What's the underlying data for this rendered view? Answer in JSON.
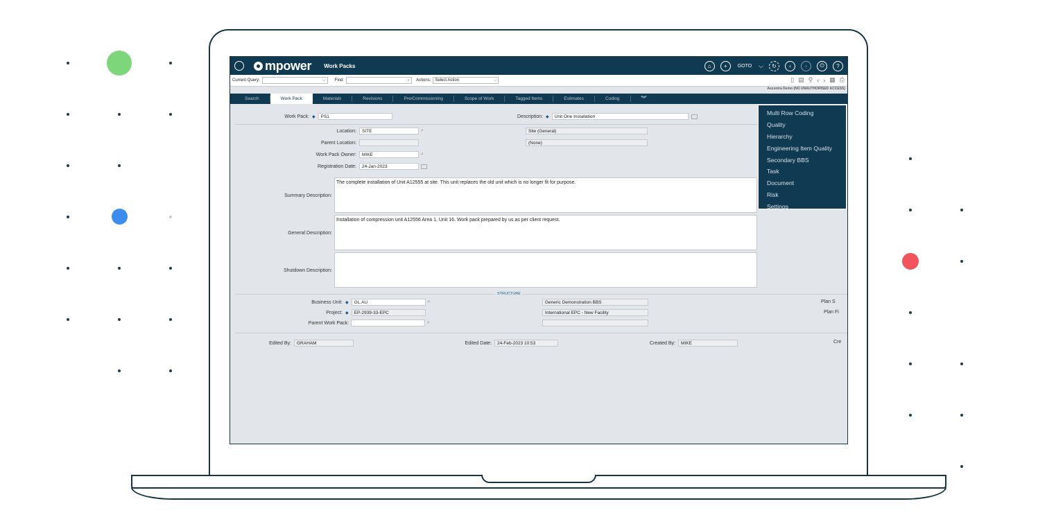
{
  "app": {
    "brand": "mpower",
    "module_title": "Work Packs",
    "goto_label": "GOTO",
    "access_note": "Ascentra Demo (NO UNAUTHORISED ACCESS)"
  },
  "querybar": {
    "current_query_label": "Current Query:",
    "current_query_value": "",
    "find_label": "Find:",
    "find_value": "",
    "actions_label": "Actions:",
    "actions_value": "Select Action"
  },
  "tabs": [
    {
      "label": "Search"
    },
    {
      "label": "Work Pack"
    },
    {
      "label": "Materials"
    },
    {
      "label": "Revisions"
    },
    {
      "label": "Pre/Commissioning"
    },
    {
      "label": "Scope of Work"
    },
    {
      "label": "Tagged Items"
    },
    {
      "label": "Estimates"
    },
    {
      "label": "Coding"
    }
  ],
  "form": {
    "work_pack_label": "Work Pack:",
    "work_pack_value": "PS1",
    "description_label": "Description:",
    "description_value": "Unit One Installation",
    "location_label": "Location:",
    "location_value": "SITE",
    "location_desc": "Site (General)",
    "parent_location_label": "Parent Location:",
    "parent_location_value": "",
    "parent_location_desc": "(None)",
    "owner_label": "Work Pack Owner:",
    "owner_value": "MIKE",
    "registration_label": "Registration Date:",
    "registration_value": "24-Jan-2023",
    "summary_label": "Summary Description:",
    "summary_value": "The complete installation of Unit A12555 at site. This unit replaces the old unit which is no longer fit for purpose.",
    "general_label": "General Description:",
    "general_value": "Installation of compression unit A12556 Area 1, Unit 16. Work pack prepared by us as per client request.",
    "shutdown_label": "Shutdown Description:",
    "shutdown_value": "",
    "structure_heading": "STRUCTURE",
    "business_unit_label": "Business Unit:",
    "business_unit_value": "GL.AU",
    "business_unit_desc": "Generic Demonstration BBS",
    "project_label": "Project:",
    "project_value": "EP-2939-33-EPC",
    "project_desc": "International EPC - New Facility",
    "parent_wp_label": "Parent Work Pack:",
    "parent_wp_value": "",
    "plan_start_label": "Plan S",
    "plan_finish_label": "Plan Fi",
    "edited_by_label": "Edited By:",
    "edited_by_value": "GRAHAM",
    "edited_date_label": "Edited Date:",
    "edited_date_value": "24-Feb-2023 10:53",
    "created_by_label": "Created By:",
    "created_by_value": "MIKE",
    "created_date_label": "Cre"
  },
  "coding_menu": [
    {
      "label": "Multi Row Coding"
    },
    {
      "label": "Quality"
    },
    {
      "label": "Hierarchy"
    },
    {
      "label": "Engineering Item Quality"
    },
    {
      "label": "Secondary BBS"
    },
    {
      "label": "Task"
    },
    {
      "label": "Document"
    },
    {
      "label": "Risk"
    },
    {
      "label": "Settings"
    }
  ],
  "colors": {
    "navy": "#0f3a52",
    "dot_green": "#7ed67a",
    "dot_blue": "#3b8df0",
    "dot_red": "#f2545b"
  }
}
